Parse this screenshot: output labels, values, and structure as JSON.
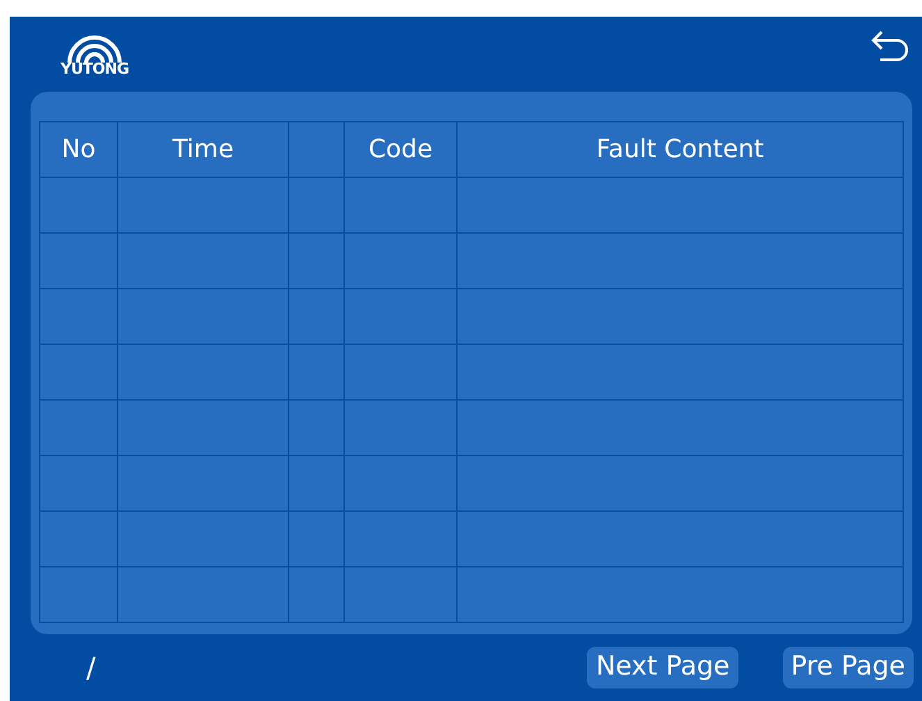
{
  "header": {
    "logo_text": "YUTONG"
  },
  "table": {
    "columns": [
      {
        "kind": "text",
        "label": "No"
      },
      {
        "kind": "text",
        "label": "Time"
      },
      {
        "kind": "blank"
      },
      {
        "kind": "text",
        "label": "Code"
      },
      {
        "kind": "text",
        "label": "Fault Content"
      }
    ]
  },
  "footer": {
    "page_indicator": "/",
    "buttons": [
      "Next Page",
      "Pre Page"
    ]
  }
}
